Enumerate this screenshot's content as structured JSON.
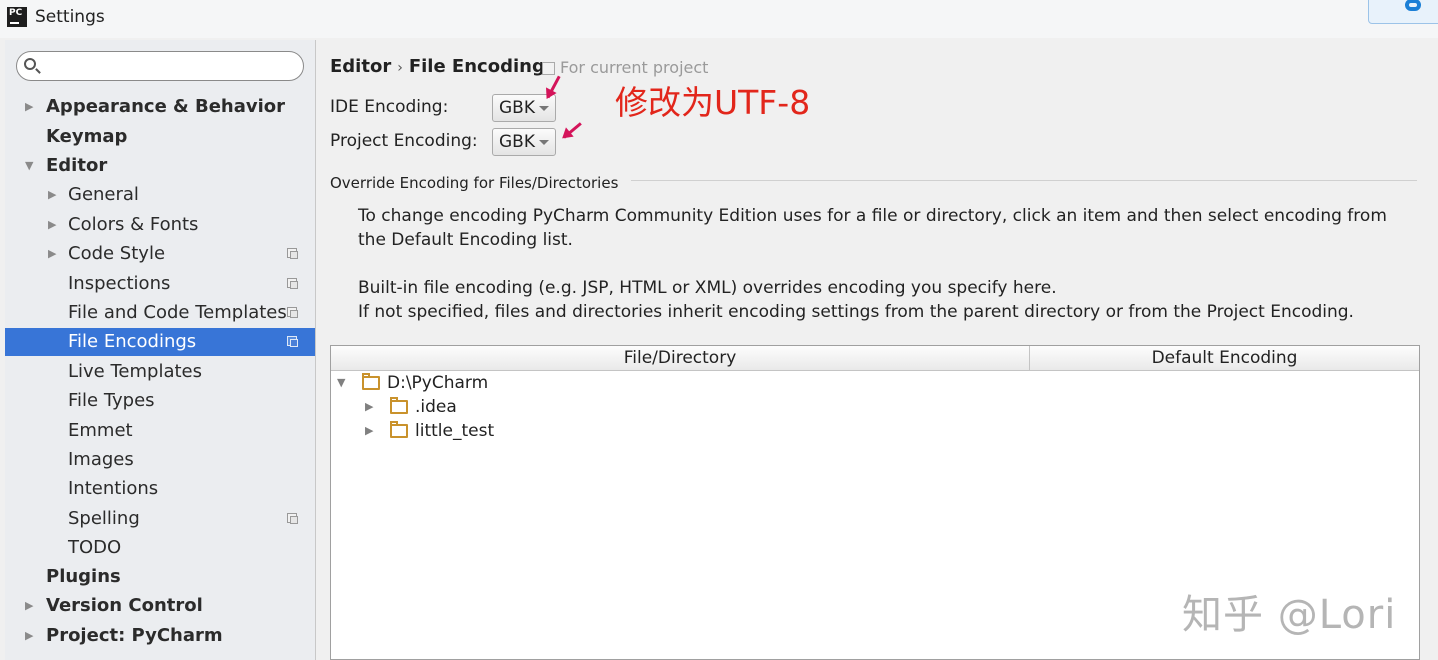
{
  "window": {
    "title": "Settings",
    "app_icon_text": "PC"
  },
  "sidebar": {
    "search": {
      "value": "",
      "placeholder": ""
    },
    "items": [
      {
        "label": "Appearance & Behavior",
        "arrow": "▶"
      },
      {
        "label": "Keymap"
      },
      {
        "label": "Editor",
        "arrow": "▼"
      },
      {
        "label": "General",
        "arrow": "▶"
      },
      {
        "label": "Colors & Fonts",
        "arrow": "▶"
      },
      {
        "label": "Code Style",
        "arrow": "▶"
      },
      {
        "label": "Inspections"
      },
      {
        "label": "File and Code Templates"
      },
      {
        "label": "File Encodings"
      },
      {
        "label": "Live Templates"
      },
      {
        "label": "File Types"
      },
      {
        "label": "Emmet"
      },
      {
        "label": "Images"
      },
      {
        "label": "Intentions"
      },
      {
        "label": "Spelling"
      },
      {
        "label": "TODO"
      },
      {
        "label": "Plugins"
      },
      {
        "label": "Version Control",
        "arrow": "▶"
      },
      {
        "label": "Project: PyCharm",
        "arrow": "▶"
      }
    ]
  },
  "main": {
    "breadcrumb": {
      "parent": "Editor",
      "separator": "›",
      "current": "File Encodings"
    },
    "scope_note": "For current project",
    "ide_encoding": {
      "label": "IDE Encoding:",
      "value": "GBK"
    },
    "project_encoding": {
      "label": "Project Encoding:",
      "value": "GBK"
    },
    "annotation": "修改为UTF-8",
    "override_section": {
      "title": "Override Encoding for Files/Directories",
      "desc1": "To change encoding PyCharm Community Edition uses for a file or directory, click an item and then select encoding from the Default Encoding list.",
      "desc2": "Built-in file encoding (e.g. JSP, HTML or XML) overrides encoding you specify here.",
      "desc3": "If not specified, files and directories inherit encoding settings from the parent directory or from the Project Encoding."
    },
    "table": {
      "columns": [
        "File/Directory",
        "Default Encoding"
      ],
      "rows": [
        {
          "name": "D:\\PyCharm",
          "arrow": "▼"
        },
        {
          "name": ".idea",
          "arrow": "▶"
        },
        {
          "name": "little_test",
          "arrow": "▶"
        }
      ]
    }
  },
  "watermark": "知乎 @Lori",
  "colors": {
    "selection": "#3875d7",
    "annotation": "#e2261b",
    "arrow_marks": "#d4145a",
    "folder": "#c9922c"
  }
}
